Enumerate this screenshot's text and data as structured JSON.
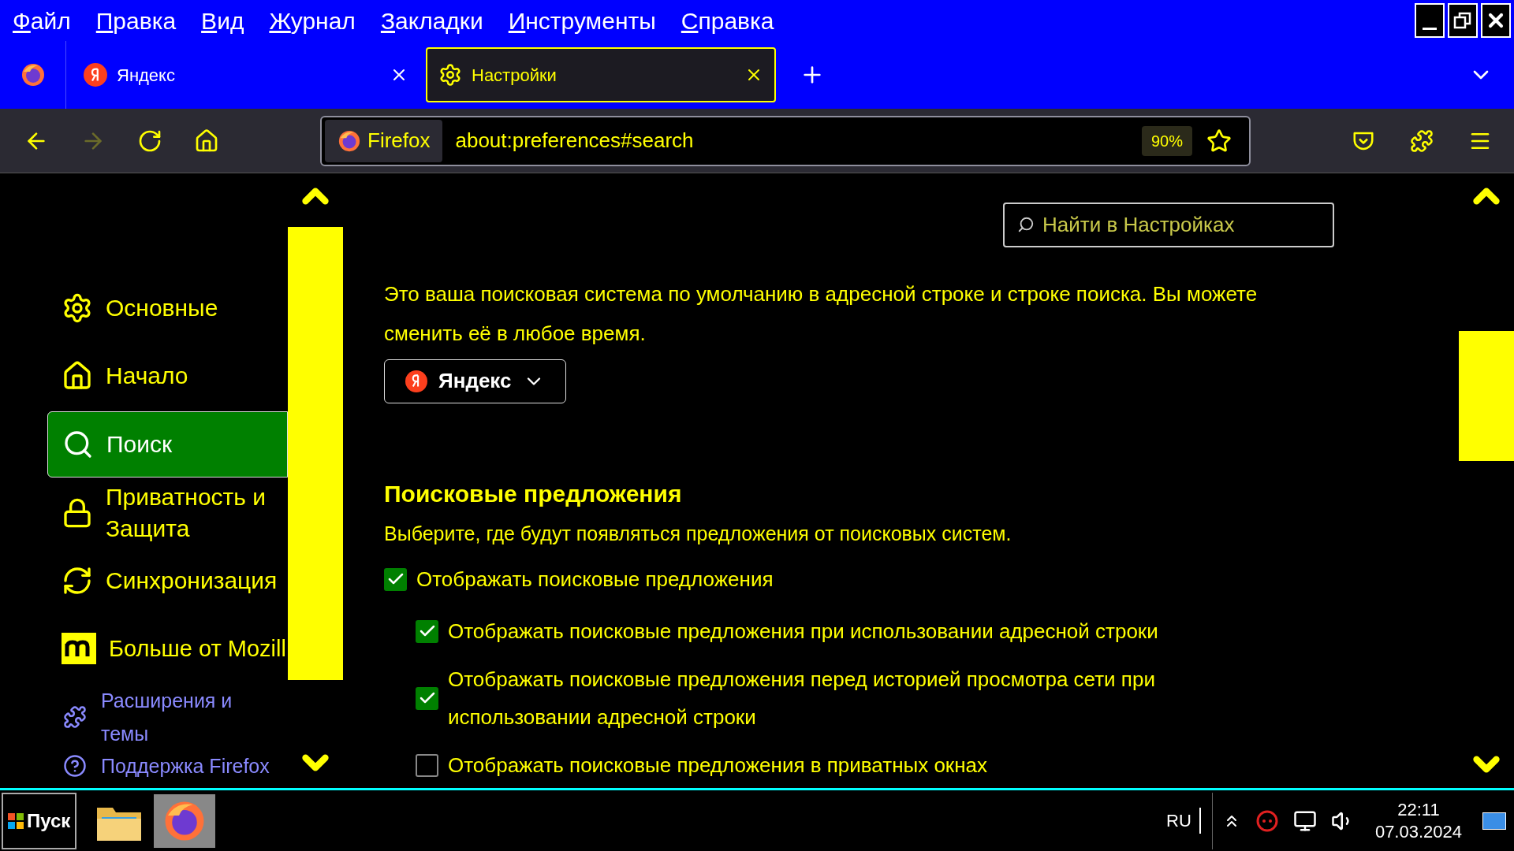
{
  "menu_bar": {
    "items": [
      "Файл",
      "Правка",
      "Вид",
      "Журнал",
      "Закладки",
      "Инструменты",
      "Справка"
    ]
  },
  "tabs": [
    {
      "label": "Яндекс",
      "kind": "yandex",
      "selected": false
    },
    {
      "label": "Настройки",
      "kind": "settings",
      "selected": true
    }
  ],
  "address_bar": {
    "identity": "Firefox",
    "url": "about:preferences#search",
    "zoom": "90%"
  },
  "sidebar": {
    "items": [
      {
        "label": "Основные",
        "kind": "gear",
        "selected": false
      },
      {
        "label": "Начало",
        "kind": "home",
        "selected": false
      },
      {
        "label": "Поиск",
        "kind": "search",
        "selected": true
      },
      {
        "label": "Приватность и Защита",
        "kind": "lock",
        "selected": false
      },
      {
        "label": "Синхронизация",
        "kind": "sync",
        "selected": false
      },
      {
        "label": "Больше от Mozill",
        "kind": "mozilla",
        "selected": false
      }
    ],
    "links": [
      {
        "label": "Расширения и темы",
        "kind": "puzzle"
      },
      {
        "label": "Поддержка Firefox",
        "kind": "help"
      }
    ]
  },
  "search": {
    "placeholder": "Найти в Настройках"
  },
  "default_engine": {
    "description": "Это ваша поисковая система по умолчанию в адресной строке и строке поиска. Вы можете сменить её в любое время.",
    "engine": "Яндекс"
  },
  "suggestions": {
    "heading": "Поисковые предложения",
    "description": "Выберите, где будут появляться предложения от поисковых систем.",
    "options": [
      {
        "label": "Отображать поисковые предложения",
        "checked": true,
        "children": [
          {
            "label": "Отображать поисковые предложения при использовании адресной строки",
            "checked": true
          },
          {
            "label": "Отображать поисковые предложения перед историей просмотра сети при использовании адресной строки",
            "checked": true
          },
          {
            "label": "Отображать поисковые предложения в приватных окнах",
            "checked": false
          }
        ]
      }
    ]
  },
  "taskbar": {
    "start": "Пуск",
    "language": "RU",
    "time": "22:11",
    "date": "07.03.2024"
  }
}
